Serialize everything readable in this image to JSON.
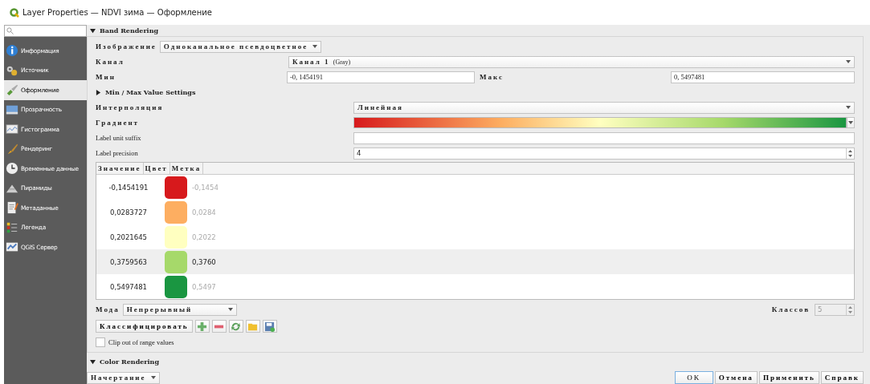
{
  "window": {
    "title": "Layer Properties — NDVI зима — Оформление"
  },
  "sidebar": {
    "items": [
      {
        "label": "Информация",
        "selected": false
      },
      {
        "label": "Источник",
        "selected": false
      },
      {
        "label": "Оформление",
        "selected": true
      },
      {
        "label": "Прозрачность",
        "selected": false
      },
      {
        "label": "Гистограмма",
        "selected": false
      },
      {
        "label": "Рендеринг",
        "selected": false
      },
      {
        "label": "Временные данные",
        "selected": false
      },
      {
        "label": "Пирамиды",
        "selected": false
      },
      {
        "label": "Метаданные",
        "selected": false
      },
      {
        "label": "Легенда",
        "selected": false
      },
      {
        "label": "QGIS Сервер",
        "selected": false
      }
    ]
  },
  "band_rendering": {
    "title": "Band Rendering",
    "expanded": true,
    "render_type": {
      "label": "Изображение",
      "value": "Одноканальное псевдоцветное"
    },
    "band": {
      "label": "Канал",
      "value": "Канал 1",
      "suffix": "(Gray)"
    },
    "min": {
      "label": "Мин",
      "value": "-0, 1454191"
    },
    "max": {
      "label": "Макс",
      "value": "0, 5497481"
    },
    "minmax_settings": {
      "title": "Min / Max Value Settings",
      "expanded": false
    },
    "interpolation": {
      "label": "Интерполяция",
      "value": "Линейная"
    },
    "gradient": {
      "label": "Градиент"
    },
    "label_unit_suffix": {
      "label": "Label unit suffix"
    },
    "label_precision": {
      "label": "Label precision",
      "value": "4"
    },
    "table": {
      "columns": [
        "Значение",
        "Цвет",
        "Метка"
      ],
      "rows": [
        {
          "value": "-0,1454191",
          "color": "#d7191c",
          "label": "-0,1454",
          "selected": false
        },
        {
          "value": "0,0283727",
          "color": "#fdae61",
          "label": "0,0284",
          "selected": false
        },
        {
          "value": "0,2021645",
          "color": "#ffffc0",
          "label": "0,2022",
          "selected": false
        },
        {
          "value": "0,3759563",
          "color": "#a6d96a",
          "label": "0,3760",
          "selected": true
        },
        {
          "value": "0,5497481",
          "color": "#1a9641",
          "label": "0,5497",
          "selected": false
        }
      ]
    },
    "mode": {
      "label": "Мода",
      "value": "Непрерывный"
    },
    "classes": {
      "label": "Классов",
      "value": "5",
      "disabled": true
    },
    "classify_button": "Классифицировать",
    "clip": {
      "label": "Clip out of range values",
      "checked": false
    }
  },
  "color_rendering": {
    "title": "Color Rendering",
    "expanded": true,
    "blend": {
      "value": "Начертание"
    }
  },
  "buttons": [
    "OK",
    "Отмена",
    "Применить",
    "Справк"
  ]
}
